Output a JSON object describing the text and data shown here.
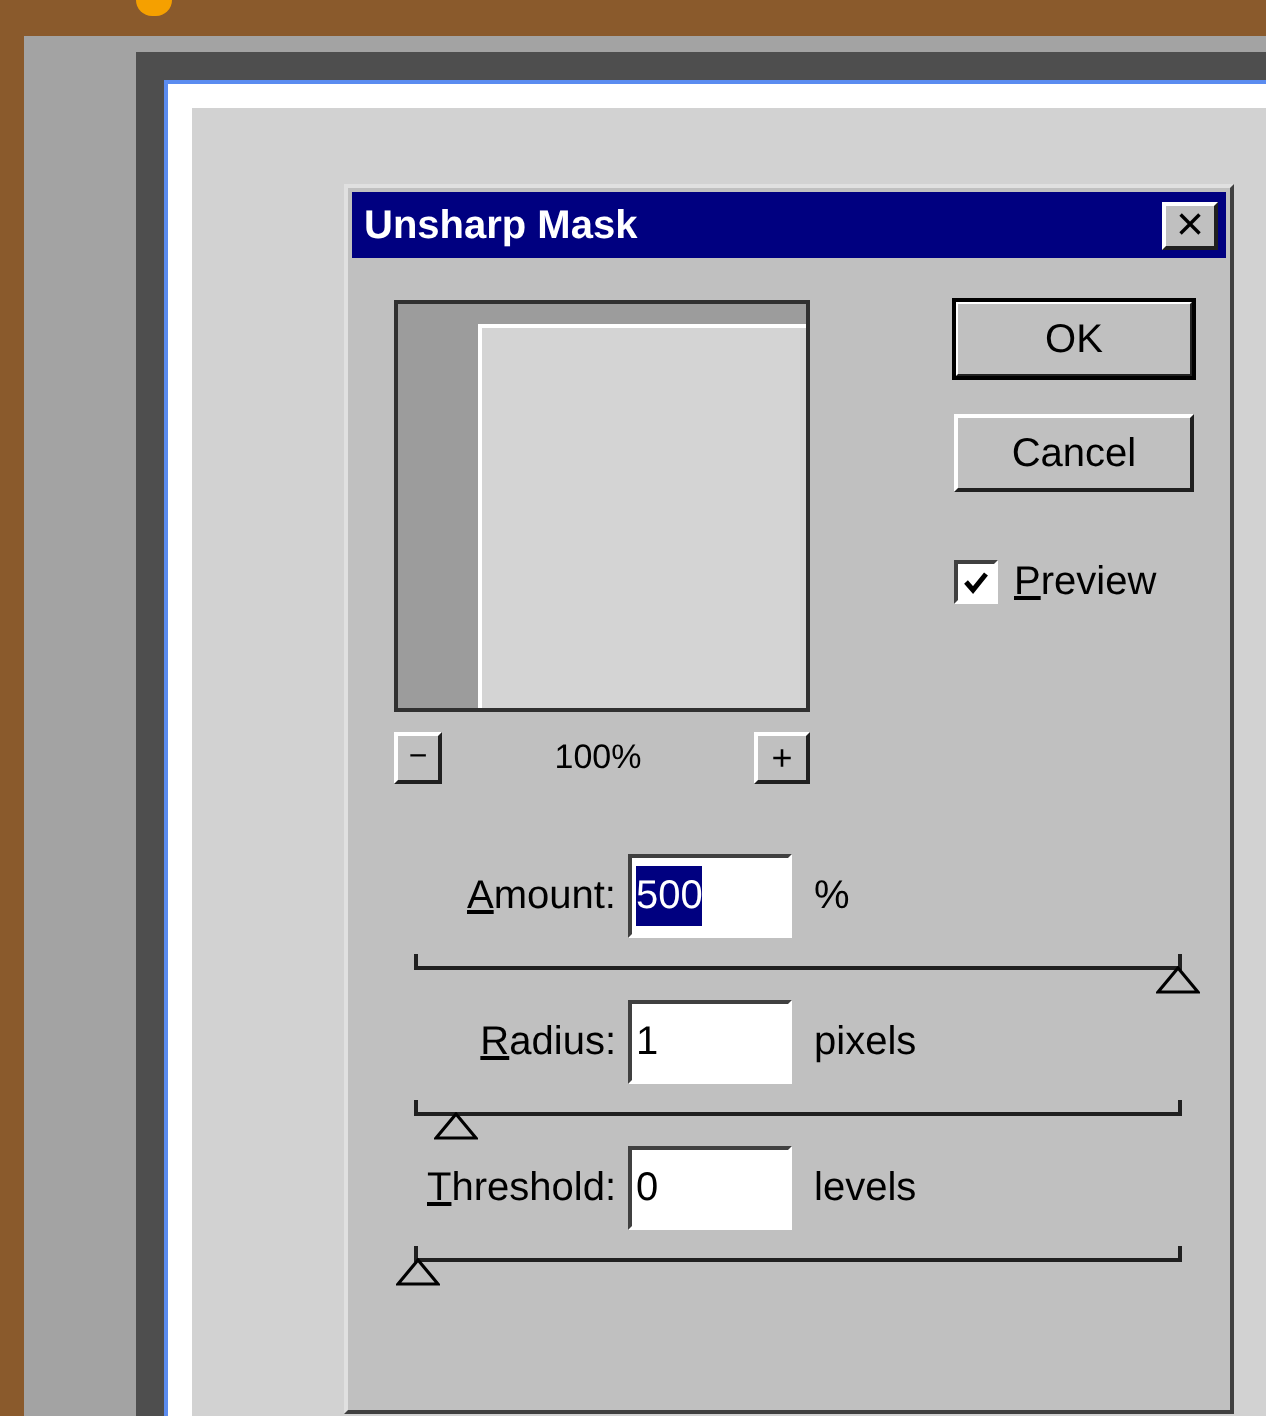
{
  "window": {
    "title": "Unsharp Mask",
    "close": "×"
  },
  "buttons": [
    {
      "label": "OK",
      "default": true
    },
    {
      "label": "Cancel",
      "default": false
    }
  ],
  "preview_checkbox": {
    "label": "Preview",
    "checked": true,
    "underline_first": true
  },
  "zoom": {
    "minus": "−",
    "value": "100%",
    "plus": "+"
  },
  "fields": [
    {
      "label": "Amount:",
      "underline_first": true,
      "value": "500",
      "selected": true,
      "unit": "%",
      "level": 1
    },
    {
      "label": "Radius:",
      "underline_first": true,
      "value": "1",
      "selected": false,
      "unit": "pixels",
      "level": 0.05
    },
    {
      "label": "Threshold:",
      "underline_first": true,
      "value": "0",
      "selected": false,
      "unit": "levels",
      "level": 0
    }
  ]
}
